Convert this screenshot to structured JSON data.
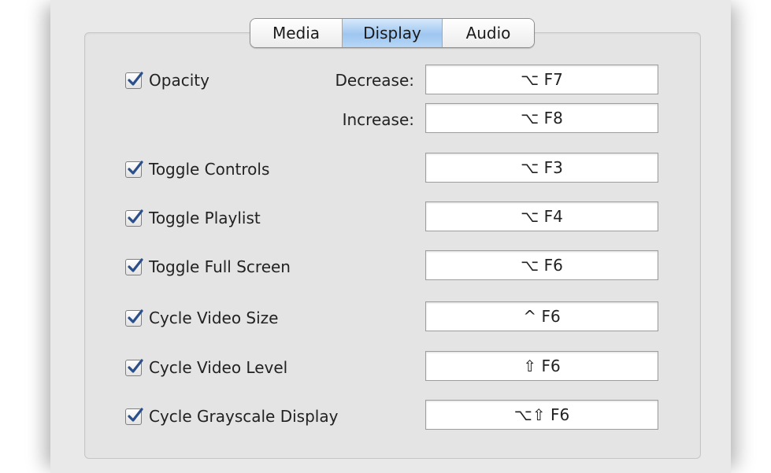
{
  "tabs": [
    {
      "label": "Media"
    },
    {
      "label": "Display"
    },
    {
      "label": "Audio"
    }
  ],
  "selected_tab": "Display",
  "opacity": {
    "label": "Opacity",
    "checked": true,
    "decrease_label": "Decrease:",
    "decrease_value": "⌥ F7",
    "increase_label": "Increase:",
    "increase_value": "⌥ F8"
  },
  "rows": [
    {
      "label": "Toggle Controls",
      "checked": true,
      "shortcut": "⌥ F3"
    },
    {
      "label": "Toggle Playlist",
      "checked": true,
      "shortcut": "⌥ F4"
    },
    {
      "label": "Toggle Full Screen",
      "checked": true,
      "shortcut": "⌥ F6"
    },
    {
      "label": "Cycle Video Size",
      "checked": true,
      "shortcut": "^ F6"
    },
    {
      "label": "Cycle Video Level",
      "checked": true,
      "shortcut": "⇧ F6"
    },
    {
      "label": "Cycle Grayscale Display",
      "checked": true,
      "shortcut": "⌥⇧ F6"
    }
  ],
  "colors": {
    "selected_tab": "#9ec6f0",
    "checkmark": "#2a4f8a"
  }
}
